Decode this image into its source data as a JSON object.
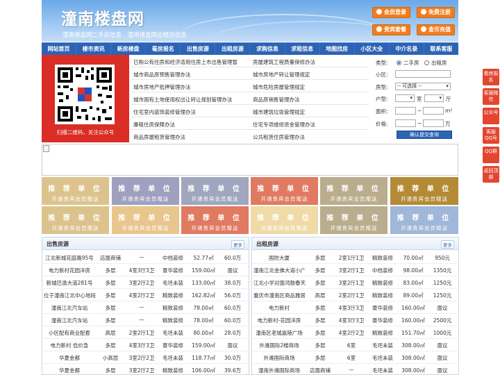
{
  "site": {
    "title": "潼南楼盘网",
    "sub_links": [
      "潼南楼盘网二手房信息",
      "潼南楼盘网出租房信息"
    ]
  },
  "header_buttons": [
    "会员登录",
    "免费注册",
    "贵宾套餐",
    "金币充值"
  ],
  "nav": [
    "网站首页",
    "楼市资讯",
    "新房楼盘",
    "看房报名",
    "出售房源",
    "出租房源",
    "求购信息",
    "求租信息",
    "地图找房",
    "小区大全",
    "中介名录",
    "联系客服"
  ],
  "qr": {
    "caption": "扫描二维码，关注公众号"
  },
  "links_left": [
    "已购公有住房和经济适用住房上市出售管理暂",
    "城市商品房预售管理办法",
    "城市房地产抵押管理办法",
    "城市国有土地使用权出让转让规划管理办法",
    "住宅室内装饰装修管理办法",
    "廉租住房保障办法",
    "商品房屋租赁管理办法"
  ],
  "links_right": [
    "房屋建筑工程质量保修办法",
    "城市房地产转让管理规定",
    "城市危险房屋管理规定",
    "商品房销售管理办法",
    "城市建筑垃圾管理规定",
    "住宅专项维修资金管理办法",
    "公共租赁住房管理办法"
  ],
  "search": {
    "type_label": "类型:",
    "type_options": [
      "二手房",
      "出租房"
    ],
    "selected_type": "二手房",
    "community_label": "小区:",
    "community_value": "",
    "house_label": "房型:",
    "house_value": "-- 可选择 --",
    "layout_label": "户型:",
    "room_unit": "室",
    "hall_unit": "厅",
    "area_label": "面积:",
    "area_unit": "m²",
    "range_sep": "~",
    "price_label": "价格:",
    "price_unit": "万",
    "submit_label": "确认提交查询"
  },
  "promo": {
    "title": "推 荐 单 位",
    "subtitle": "开通贵宾会员赠送",
    "colors": [
      "#dcc38e",
      "#9f9fbf",
      "#9fa6bd",
      "#e07a60",
      "#b9ad8d",
      "#b48a35",
      "#dcc38e",
      "#e8c68e",
      "#e07a60",
      "#f0dba8",
      "#b9ad8d",
      "#9fb7d8"
    ]
  },
  "side_float": [
    "看房报名",
    "客服微信",
    "公众号",
    "客服QQ号",
    "QQ群",
    "返回顶部"
  ],
  "sale": {
    "title": "出售房源",
    "more": "更多",
    "rows": [
      [
        "江北新城花庭路95号",
        "店面商铺",
        "—",
        "中档装修",
        "52.77㎡",
        "60.0万"
      ],
      [
        "电力新村花园洋房",
        "多层",
        "4室3厅3卫",
        "豪华装修",
        "159.00㎡",
        "面议"
      ],
      [
        "新城巴渝大道281号",
        "多层",
        "3室2厅2卫",
        "毛坯未装",
        "133.00㎡",
        "38.0万"
      ],
      [
        "位于潼南江北中心地段",
        "多层",
        "4室2厅2卫",
        "精致装修",
        "162.82㎡",
        "56.0万"
      ],
      [
        "潼南江北汽车站",
        "多层",
        "—",
        "精致装修",
        "78.00㎡",
        "60.0万"
      ],
      [
        "潼南江北汽车站",
        "多层",
        "—",
        "精致装修",
        "78.00㎡",
        "60.0万"
      ],
      [
        "小区配有商业配套",
        "高层",
        "2室2厅1卫",
        "毛坯未装",
        "80.00㎡",
        "28.0万"
      ],
      [
        "电力新村 低价急",
        "多层",
        "4室3厅3卫",
        "豪华装修",
        "159.00㎡",
        "面议"
      ],
      [
        "华夏金都",
        "小高层",
        "3室2厅2卫",
        "毛坯未装",
        "118.77㎡",
        "30.0万"
      ],
      [
        "华夏金都",
        "多层",
        "3室2厅2卫",
        "精致装修",
        "106.00㎡",
        "39.6万"
      ]
    ]
  },
  "rent": {
    "title": "出租房源",
    "more": "更多",
    "rows": [
      [
        "国防大厦",
        "多层",
        "2室1厅1卫",
        "精致装修",
        "70.00㎡",
        "950元"
      ],
      [
        "潼南江北金佛大道小广",
        "多层",
        "3室2厅1卫",
        "中档装修",
        "98.00㎡",
        "1350元"
      ],
      [
        "江北小学对面鸿鼓春天",
        "多层",
        "3室2厅1卫",
        "精致装修",
        "83.00㎡",
        "1250元"
      ],
      [
        "重庆市潼南区商品雅居",
        "高层",
        "2室2厅1卫",
        "精致装修",
        "89.00㎡",
        "1250元"
      ],
      [
        "电力新村",
        "多层",
        "4室3厅3卫",
        "豪华装修",
        "160.00㎡",
        "面议"
      ],
      [
        "电力新村-花园洋房",
        "多层",
        "4室3厅3卫",
        "豪华装修",
        "160.00㎡",
        "2500元"
      ],
      [
        "潼南区老城嘉陵广场",
        "多层",
        "4室2厅2卫",
        "精致装修",
        "151.70㎡",
        "1000元"
      ],
      [
        "外滩国际2楼商场",
        "多层",
        "6室",
        "毛坯未装",
        "308.00㎡",
        "面议"
      ],
      [
        "外滩国际商场",
        "多层",
        "6室",
        "毛坯未装",
        "308.00㎡",
        "面议"
      ],
      [
        "潼南外滩国际商场",
        "店面商铺",
        "—",
        "毛坯未装",
        "308.00㎡",
        "面议"
      ]
    ]
  }
}
